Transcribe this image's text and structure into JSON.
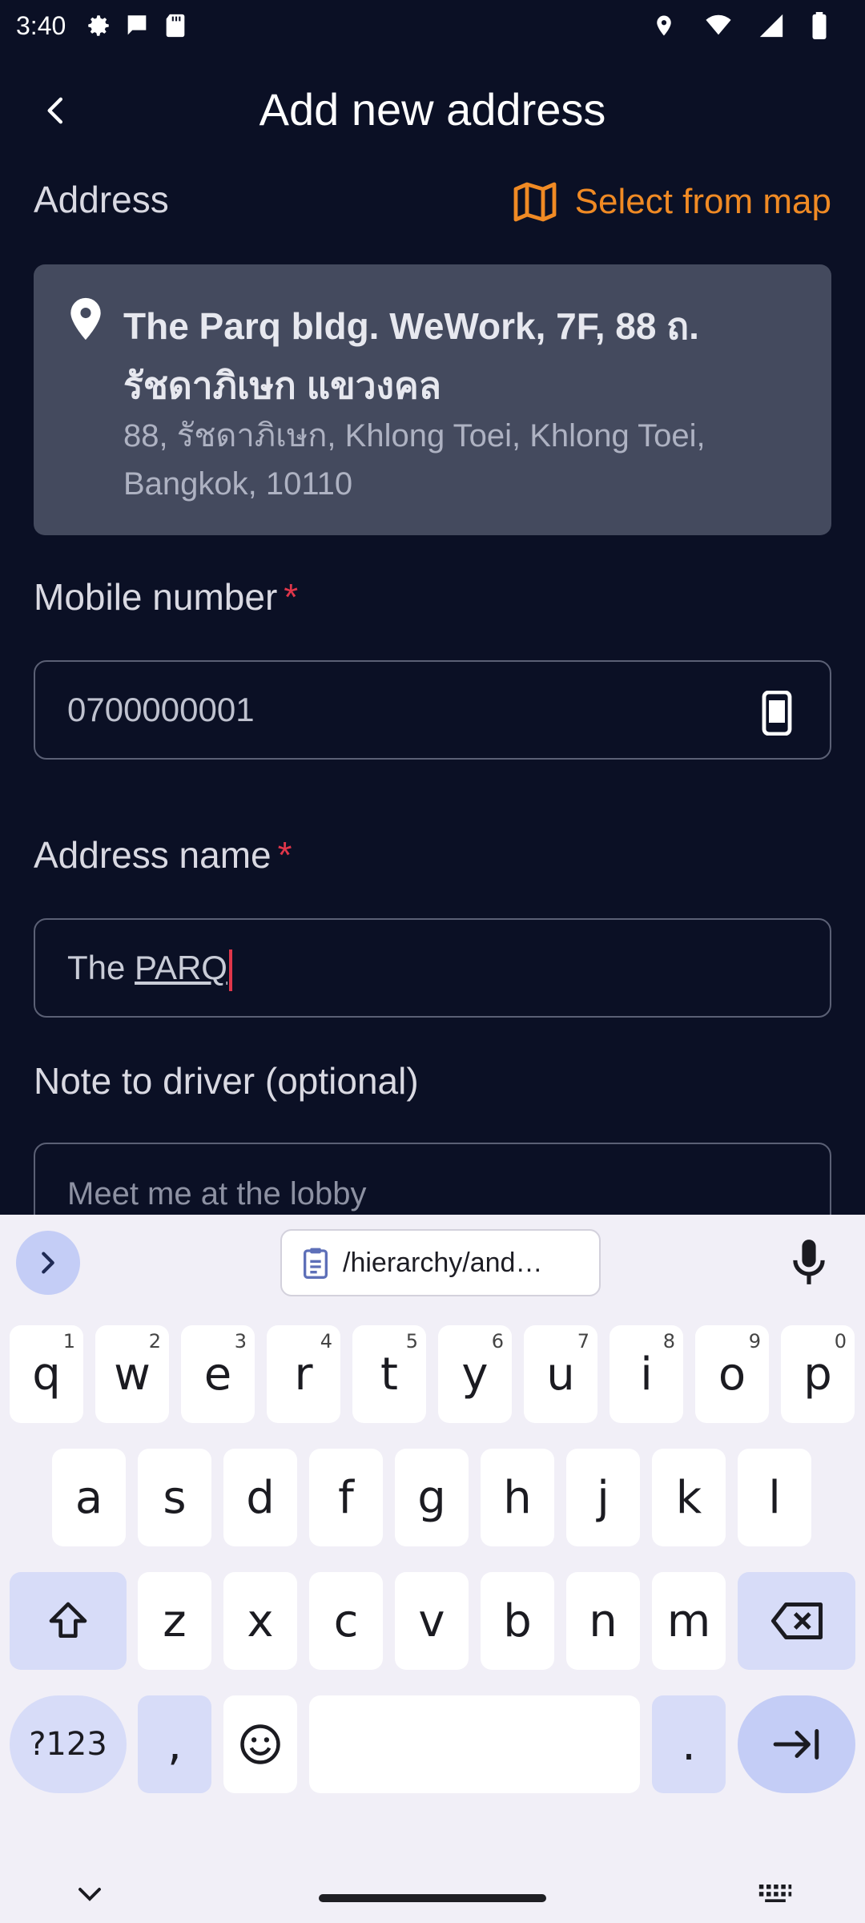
{
  "status_bar": {
    "time": "3:40"
  },
  "header": {
    "title": "Add new address"
  },
  "address_section": {
    "label": "Address",
    "select_from_map": "Select from map",
    "card": {
      "line1": "The Parq bldg. WeWork, 7F, 88 ถ. รัชดาภิเษก แขวงคล",
      "line2": "88, รัชดาภิเษก, Khlong Toei, Khlong Toei, Bangkok, 10110"
    }
  },
  "mobile": {
    "label": "Mobile number",
    "required": "*",
    "value": "0700000001"
  },
  "address_name": {
    "label": "Address name",
    "required": "*",
    "value_prefix": "The ",
    "value_underlined": "PARQ"
  },
  "note": {
    "label": "Note to driver (optional)",
    "placeholder": "Meet me at the lobby"
  },
  "keyboard": {
    "clipboard_chip": "/hierarchy/and…",
    "row1": [
      {
        "k": "q",
        "h": "1"
      },
      {
        "k": "w",
        "h": "2"
      },
      {
        "k": "e",
        "h": "3"
      },
      {
        "k": "r",
        "h": "4"
      },
      {
        "k": "t",
        "h": "5"
      },
      {
        "k": "y",
        "h": "6"
      },
      {
        "k": "u",
        "h": "7"
      },
      {
        "k": "i",
        "h": "8"
      },
      {
        "k": "o",
        "h": "9"
      },
      {
        "k": "p",
        "h": "0"
      }
    ],
    "row2": [
      "a",
      "s",
      "d",
      "f",
      "g",
      "h",
      "j",
      "k",
      "l"
    ],
    "row3": [
      "z",
      "x",
      "c",
      "v",
      "b",
      "n",
      "m"
    ],
    "symbols_key": "?123",
    "comma_key": ",",
    "period_key": "."
  },
  "colors": {
    "accent": "#f08a24",
    "background": "#0b1025",
    "required": "#e0364a"
  }
}
